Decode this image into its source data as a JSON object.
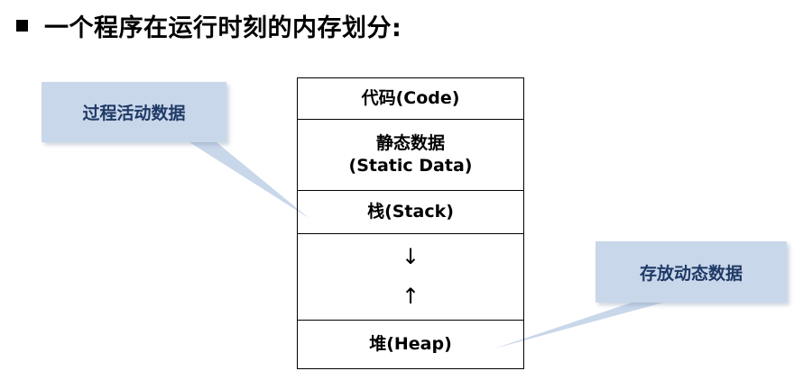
{
  "heading": "一个程序在运行时刻的内存划分:",
  "segments": {
    "code": "代码(Code)",
    "static_line1": "静态数据",
    "static_line2": "(Static Data)",
    "stack": "栈(Stack)",
    "arrow_down": "↓",
    "arrow_up": "↑",
    "heap": "堆(Heap)"
  },
  "callouts": {
    "left": "过程活动数据",
    "right": "存放动态数据"
  },
  "colors": {
    "callout_fill": "#c9d7ea",
    "callout_text": "#1f3a66"
  }
}
